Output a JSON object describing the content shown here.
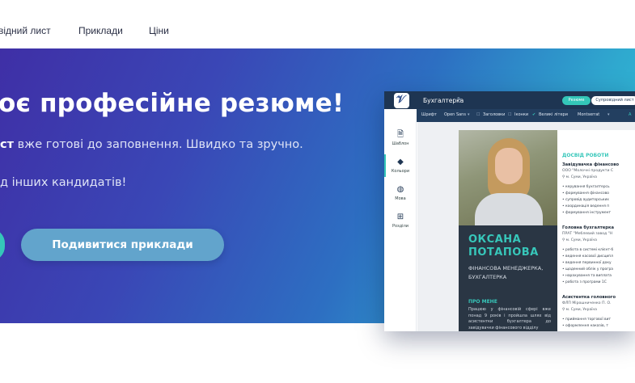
{
  "nav": {
    "items": [
      {
        "label": "відний лист"
      },
      {
        "label": "Приклади"
      },
      {
        "label": "Ціни"
      }
    ]
  },
  "hero": {
    "title": "оє професійне резюме!",
    "subtitle_bold": "ст",
    "subtitle_rest": " вже готові до заповнення. Швидко та зручно.",
    "subtitle2": "д інших кандидатів!",
    "examples_button": "Подивитися приклади"
  },
  "colors": {
    "accent": "#34c6b8",
    "hero_start": "#3f2fa6",
    "hero_end": "#33c6d6",
    "editor_dark": "#1e3552"
  },
  "editor": {
    "filename": "Бухгалтерка",
    "tabs": {
      "resume": "Резюме",
      "cover": "Супровідний лист"
    },
    "toolbar": {
      "font_label": "Шрифт",
      "font_value": "Open Sans",
      "headings": "Заголовки",
      "icons": "Іконки",
      "caps": "Великі літери",
      "heading_font": "Montserrat"
    },
    "sidebar": [
      {
        "label": "Шаблон",
        "icon": "document-icon"
      },
      {
        "label": "Кольори",
        "icon": "paint-bucket-icon"
      },
      {
        "label": "Мова",
        "icon": "globe-icon"
      },
      {
        "label": "Розділи",
        "icon": "grid-icon"
      }
    ]
  },
  "resume": {
    "name_line1": "ОКСАНА",
    "name_line2": "ПОТАПОВА",
    "role_line1": "ФІНАНСОВА МЕНЕДЖЕРКА,",
    "role_line2": "БУХГАЛТЕРКА",
    "about_heading": "ПРО МЕНЕ",
    "about_text": "Працюю у фінансовій сфері вже понад 9 років і пройшла шлях від асистентки бухгалтера до завідувачки фінансового відділу",
    "experience_heading": "ДОСВІД РОБОТИ",
    "jobs": [
      {
        "title": "Завідувачка фінансово",
        "company": "ООО \"Молочні продукти С",
        "location": "м. Суми, Україна",
        "bullets": [
          "керування бухгалтерсь",
          "формування фінансово",
          "супровід аудиторських",
          "координація ведення п",
          "формування інструмент"
        ]
      },
      {
        "title": "Головна бухгалтерка",
        "company": "ПРАТ \"Меблевий завод \"Н",
        "location": "м. Суми, Україна",
        "bullets": [
          "робота в системі клієнт-б",
          "ведення касової дисципл",
          "ведення первинної доку",
          "щоденний облік у програ",
          "нарахування та виплата",
          "робота з програми 1С"
        ]
      },
      {
        "title": "Асистентка головного",
        "company": "ФЛП Мірошниченко П. О.",
        "location": "м. Суми, Україна",
        "bullets": [
          "приймання торгової вит",
          "оформлення наказів, т"
        ]
      }
    ]
  }
}
